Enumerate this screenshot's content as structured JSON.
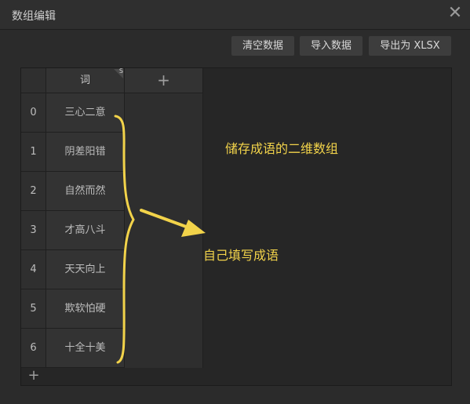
{
  "window": {
    "title": "数组编辑",
    "close_symbol": "✕"
  },
  "toolbar": {
    "clear_label": "清空数据",
    "import_label": "导入数据",
    "export_label": "导出为 XLSX"
  },
  "grid": {
    "column_header": "词",
    "sort_marker": "S",
    "add_column_symbol": "+",
    "add_row_symbol": "+",
    "rows": [
      {
        "index": "0",
        "value": "三心二意"
      },
      {
        "index": "1",
        "value": "阴差阳错"
      },
      {
        "index": "2",
        "value": "自然而然"
      },
      {
        "index": "3",
        "value": "才高八斗"
      },
      {
        "index": "4",
        "value": "天天向上"
      },
      {
        "index": "5",
        "value": "欺软怕硬"
      },
      {
        "index": "6",
        "value": "十全十美"
      }
    ]
  },
  "annotations": {
    "note1": "储存成语的二维数组",
    "note2": "自己填写成语",
    "color": "#f2d34a"
  }
}
